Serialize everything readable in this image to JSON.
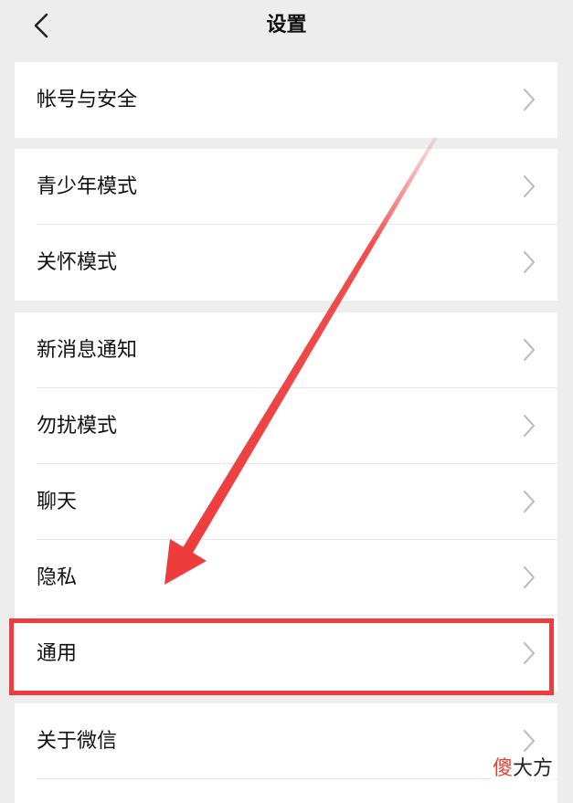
{
  "nav": {
    "title": "设置",
    "back_icon": "chevron-left-icon"
  },
  "groups": [
    {
      "items": [
        {
          "label": "帐号与安全"
        }
      ]
    },
    {
      "items": [
        {
          "label": "青少年模式"
        },
        {
          "label": "关怀模式"
        }
      ]
    },
    {
      "items": [
        {
          "label": "新消息通知"
        },
        {
          "label": "勿扰模式"
        },
        {
          "label": "聊天"
        },
        {
          "label": "隐私"
        },
        {
          "label": "通用"
        }
      ]
    },
    {
      "items": [
        {
          "label": "关于微信"
        }
      ]
    }
  ],
  "annotation": {
    "highlight_color": "#ee3b3b",
    "highlighted_item": "通用"
  },
  "watermark": {
    "first_char": "傻",
    "rest": "大方"
  }
}
